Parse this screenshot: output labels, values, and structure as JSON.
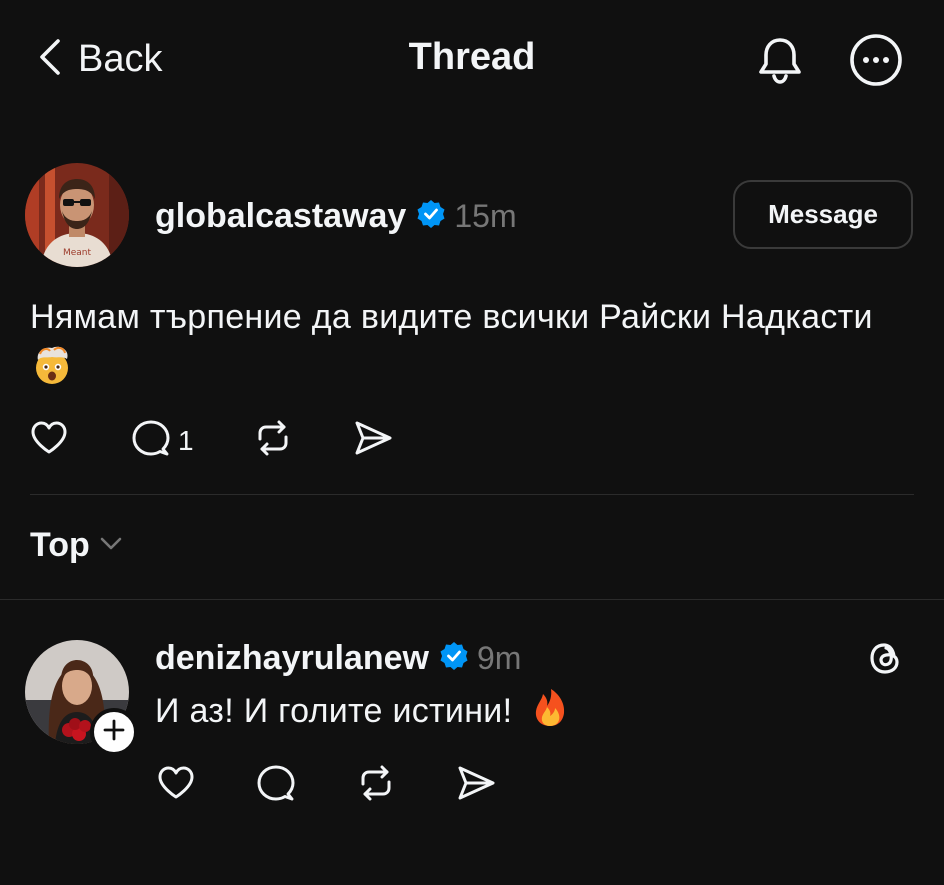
{
  "header": {
    "back_label": "Back",
    "title": "Thread"
  },
  "post": {
    "username": "globalcastaway",
    "time": "15m",
    "message_button": "Message",
    "text": "Нямам търпение да видите всички Райски Надкасти",
    "emoji": "exploding-head",
    "reply_count": "1"
  },
  "sort": {
    "label": "Top"
  },
  "reply": {
    "username": "denizhayrulanew",
    "time": "9m",
    "text": "И аз! И голите истини!",
    "emoji": "fire"
  },
  "colors": {
    "background": "#101010",
    "text": "#f3f5f7",
    "muted": "#777777",
    "verified": "#0095f6",
    "divider": "#2b2b2b"
  },
  "icons": [
    "chevron-left-icon",
    "bell-icon",
    "more-icon",
    "verified-icon",
    "heart-icon",
    "comment-icon",
    "repost-icon",
    "share-icon",
    "chevron-down-icon",
    "threads-logo-icon",
    "plus-icon"
  ]
}
